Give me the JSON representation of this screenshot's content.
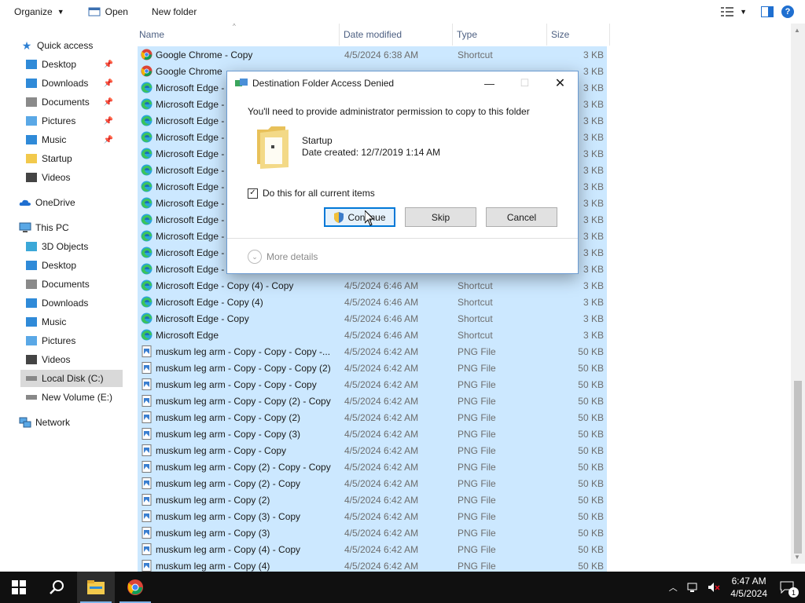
{
  "toolbar": {
    "organize": "Organize",
    "open": "Open",
    "new_folder": "New folder"
  },
  "nav": {
    "quick_access": "Quick access",
    "quick_items": [
      {
        "label": "Desktop",
        "icon": "desktop-icon",
        "pinned": true
      },
      {
        "label": "Downloads",
        "icon": "downloads-icon",
        "pinned": true
      },
      {
        "label": "Documents",
        "icon": "documents-icon",
        "pinned": true
      },
      {
        "label": "Pictures",
        "icon": "pictures-icon",
        "pinned": true
      },
      {
        "label": "Music",
        "icon": "music-icon",
        "pinned": true
      },
      {
        "label": "Startup",
        "icon": "folder-icon",
        "pinned": false
      },
      {
        "label": "Videos",
        "icon": "videos-icon",
        "pinned": false
      }
    ],
    "onedrive": "OneDrive",
    "this_pc": "This PC",
    "pc_items": [
      {
        "label": "3D Objects"
      },
      {
        "label": "Desktop"
      },
      {
        "label": "Documents"
      },
      {
        "label": "Downloads"
      },
      {
        "label": "Music"
      },
      {
        "label": "Pictures"
      },
      {
        "label": "Videos"
      },
      {
        "label": "Local Disk (C:)"
      },
      {
        "label": "New Volume (E:)"
      }
    ],
    "network": "Network"
  },
  "columns": {
    "name": "Name",
    "date": "Date modified",
    "type": "Type",
    "size": "Size"
  },
  "files": [
    {
      "name": "Google Chrome - Copy",
      "date": "4/5/2024 6:38 AM",
      "type": "Shortcut",
      "size": "3 KB",
      "icon": "chrome"
    },
    {
      "name": "Google Chrome",
      "date": "",
      "type": "",
      "size": "3 KB",
      "icon": "chrome"
    },
    {
      "name": "Microsoft Edge -",
      "date": "",
      "type": "",
      "size": "3 KB",
      "icon": "edge"
    },
    {
      "name": "Microsoft Edge -",
      "date": "",
      "type": "",
      "size": "3 KB",
      "icon": "edge"
    },
    {
      "name": "Microsoft Edge -",
      "date": "",
      "type": "",
      "size": "3 KB",
      "icon": "edge"
    },
    {
      "name": "Microsoft Edge -",
      "date": "",
      "type": "",
      "size": "3 KB",
      "icon": "edge"
    },
    {
      "name": "Microsoft Edge -",
      "date": "",
      "type": "",
      "size": "3 KB",
      "icon": "edge"
    },
    {
      "name": "Microsoft Edge -",
      "date": "",
      "type": "",
      "size": "3 KB",
      "icon": "edge"
    },
    {
      "name": "Microsoft Edge -",
      "date": "",
      "type": "",
      "size": "3 KB",
      "icon": "edge"
    },
    {
      "name": "Microsoft Edge -",
      "date": "",
      "type": "",
      "size": "3 KB",
      "icon": "edge"
    },
    {
      "name": "Microsoft Edge -",
      "date": "",
      "type": "",
      "size": "3 KB",
      "icon": "edge"
    },
    {
      "name": "Microsoft Edge -",
      "date": "",
      "type": "",
      "size": "3 KB",
      "icon": "edge"
    },
    {
      "name": "Microsoft Edge -",
      "date": "",
      "type": "",
      "size": "3 KB",
      "icon": "edge"
    },
    {
      "name": "Microsoft Edge -",
      "date": "",
      "type": "",
      "size": "3 KB",
      "icon": "edge"
    },
    {
      "name": "Microsoft Edge - Copy (4) - Copy",
      "date": "4/5/2024 6:46 AM",
      "type": "Shortcut",
      "size": "3 KB",
      "icon": "edge"
    },
    {
      "name": "Microsoft Edge - Copy (4)",
      "date": "4/5/2024 6:46 AM",
      "type": "Shortcut",
      "size": "3 KB",
      "icon": "edge"
    },
    {
      "name": "Microsoft Edge - Copy",
      "date": "4/5/2024 6:46 AM",
      "type": "Shortcut",
      "size": "3 KB",
      "icon": "edge"
    },
    {
      "name": "Microsoft Edge",
      "date": "4/5/2024 6:46 AM",
      "type": "Shortcut",
      "size": "3 KB",
      "icon": "edge"
    },
    {
      "name": "muskum leg arm - Copy - Copy - Copy -...",
      "date": "4/5/2024 6:42 AM",
      "type": "PNG File",
      "size": "50 KB",
      "icon": "png"
    },
    {
      "name": "muskum leg arm - Copy - Copy - Copy (2)",
      "date": "4/5/2024 6:42 AM",
      "type": "PNG File",
      "size": "50 KB",
      "icon": "png"
    },
    {
      "name": "muskum leg arm - Copy - Copy - Copy",
      "date": "4/5/2024 6:42 AM",
      "type": "PNG File",
      "size": "50 KB",
      "icon": "png"
    },
    {
      "name": "muskum leg arm - Copy - Copy (2) - Copy",
      "date": "4/5/2024 6:42 AM",
      "type": "PNG File",
      "size": "50 KB",
      "icon": "png"
    },
    {
      "name": "muskum leg arm - Copy - Copy (2)",
      "date": "4/5/2024 6:42 AM",
      "type": "PNG File",
      "size": "50 KB",
      "icon": "png"
    },
    {
      "name": "muskum leg arm - Copy - Copy (3)",
      "date": "4/5/2024 6:42 AM",
      "type": "PNG File",
      "size": "50 KB",
      "icon": "png"
    },
    {
      "name": "muskum leg arm - Copy - Copy",
      "date": "4/5/2024 6:42 AM",
      "type": "PNG File",
      "size": "50 KB",
      "icon": "png"
    },
    {
      "name": "muskum leg arm - Copy (2) - Copy - Copy",
      "date": "4/5/2024 6:42 AM",
      "type": "PNG File",
      "size": "50 KB",
      "icon": "png"
    },
    {
      "name": "muskum leg arm - Copy (2) - Copy",
      "date": "4/5/2024 6:42 AM",
      "type": "PNG File",
      "size": "50 KB",
      "icon": "png"
    },
    {
      "name": "muskum leg arm - Copy (2)",
      "date": "4/5/2024 6:42 AM",
      "type": "PNG File",
      "size": "50 KB",
      "icon": "png"
    },
    {
      "name": "muskum leg arm - Copy (3) - Copy",
      "date": "4/5/2024 6:42 AM",
      "type": "PNG File",
      "size": "50 KB",
      "icon": "png"
    },
    {
      "name": "muskum leg arm - Copy (3)",
      "date": "4/5/2024 6:42 AM",
      "type": "PNG File",
      "size": "50 KB",
      "icon": "png"
    },
    {
      "name": "muskum leg arm - Copy (4) - Copy",
      "date": "4/5/2024 6:42 AM",
      "type": "PNG File",
      "size": "50 KB",
      "icon": "png"
    },
    {
      "name": "muskum leg arm - Copy (4)",
      "date": "4/5/2024 6:42 AM",
      "type": "PNG File",
      "size": "50 KB",
      "icon": "png"
    },
    {
      "name": "muskum leg arm - Copy",
      "date": "4/5/2024 6:42 AM",
      "type": "PNG File",
      "size": "50 KB",
      "icon": "png"
    }
  ],
  "dialog": {
    "title": "Destination Folder Access Denied",
    "message": "You'll need to provide administrator permission to copy to this folder",
    "folder_name": "Startup",
    "folder_date": "Date created: 12/7/2019 1:14 AM",
    "checkbox_label": "Do this for all current items",
    "checkbox_checked": true,
    "continue": "Continue",
    "skip": "Skip",
    "cancel": "Cancel",
    "more_details": "More details"
  },
  "taskbar": {
    "time": "6:47 AM",
    "date": "4/5/2024",
    "notification_count": "1"
  }
}
